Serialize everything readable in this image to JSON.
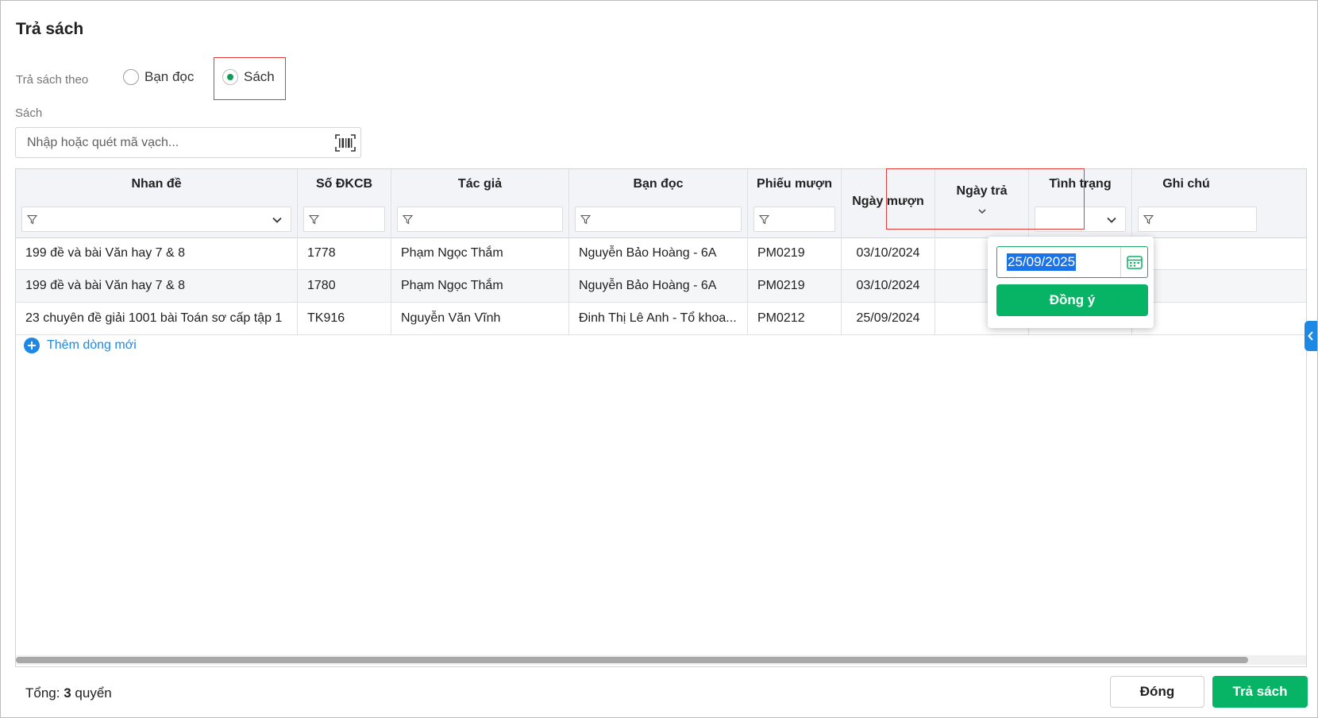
{
  "dialog": {
    "title": "Trả sách",
    "mode": {
      "label": "Trả sách theo",
      "options": [
        "Bạn đọc",
        "Sách"
      ],
      "selected": "Sách"
    },
    "book_field": {
      "label": "Sách",
      "placeholder": "Nhập hoặc quét mã vạch...",
      "value": ""
    }
  },
  "table": {
    "columns": [
      "Nhan đề",
      "Số ĐKCB",
      "Tác giả",
      "Bạn đọc",
      "Phiếu mượn",
      "Ngày mượn",
      "Ngày trả",
      "Tình trạng",
      "Ghi chú"
    ],
    "rows": [
      [
        "199 đề và bài Văn hay 7 & 8",
        "1778",
        "Phạm Ngọc Thắm",
        "Nguyễn Bảo Hoàng - 6A",
        "PM0219",
        "03/10/2024",
        "",
        "",
        ""
      ],
      [
        "199 đề và bài Văn hay 7 & 8",
        "1780",
        "Phạm Ngọc Thắm",
        "Nguyễn Bảo Hoàng - 6A",
        "PM0219",
        "03/10/2024",
        "",
        "",
        ""
      ],
      [
        "23 chuyên đề giải 1001 bài Toán sơ cấp tập 1",
        "TK916",
        "Nguyễn Văn Vĩnh",
        "Đinh Thị Lê Anh - Tổ khoa...",
        "PM0212",
        "25/09/2024",
        "",
        "",
        ""
      ]
    ],
    "add_row_label": "Thêm dòng mới"
  },
  "date_popup": {
    "value": "25/09/2025",
    "confirm_label": "Đồng ý"
  },
  "footer": {
    "total_prefix": "Tổng:",
    "total_count": "3",
    "total_unit": "quyển",
    "close_label": "Đóng",
    "return_label": "Trả sách"
  },
  "colors": {
    "primary_green": "#07b365",
    "link_blue": "#1e88e5",
    "highlight_red": "#e53935",
    "header_bg": "#f3f4f7"
  }
}
